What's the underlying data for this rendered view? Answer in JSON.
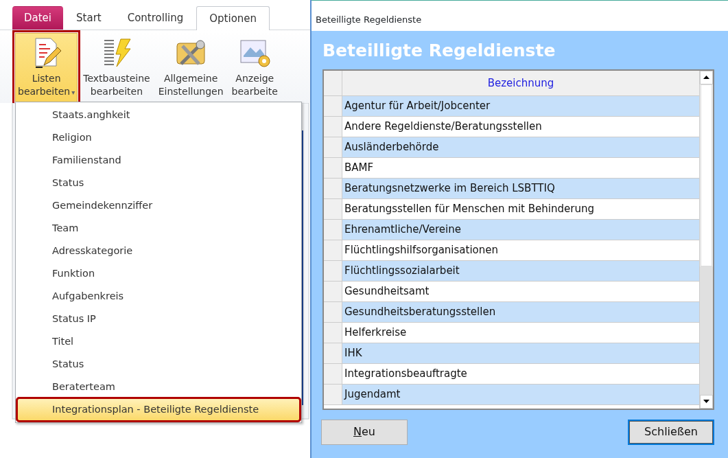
{
  "ribbon": {
    "tabs": [
      {
        "label": "Datei",
        "kind": "file",
        "selected": false
      },
      {
        "label": "Start",
        "kind": "tab",
        "selected": false
      },
      {
        "label": "Controlling",
        "kind": "tab",
        "selected": false
      },
      {
        "label": "Optionen",
        "kind": "tab",
        "selected": true
      }
    ],
    "buttons": [
      {
        "lines": [
          "Listen",
          "bearbeiten"
        ],
        "kind": "list",
        "caret": "▾",
        "selected": true,
        "highlighted": true
      },
      {
        "lines": [
          "Textbausteine",
          "bearbeiten"
        ],
        "kind": "text",
        "selected": false,
        "highlighted": false
      },
      {
        "lines": [
          "Allgemeine",
          "Einstellungen"
        ],
        "kind": "tools",
        "selected": false,
        "highlighted": false
      },
      {
        "lines": [
          "Anzeige",
          "bearbeite"
        ],
        "kind": "display",
        "selected": false,
        "highlighted": false
      }
    ]
  },
  "menu": {
    "items": [
      {
        "label": "Staats.anghkeit",
        "selected": false,
        "highlighted": false
      },
      {
        "label": "Religion",
        "selected": false,
        "highlighted": false
      },
      {
        "label": "Familienstand",
        "selected": false,
        "highlighted": false
      },
      {
        "label": "Status",
        "selected": false,
        "highlighted": false
      },
      {
        "label": "Gemeindekennziffer",
        "selected": false,
        "highlighted": false
      },
      {
        "label": "Team",
        "selected": false,
        "highlighted": false
      },
      {
        "label": "Adresskategorie",
        "selected": false,
        "highlighted": false
      },
      {
        "label": "Funktion",
        "selected": false,
        "highlighted": false
      },
      {
        "label": "Aufgabenkreis",
        "selected": false,
        "highlighted": false
      },
      {
        "label": "Status IP",
        "selected": false,
        "highlighted": false
      },
      {
        "label": "Titel",
        "selected": false,
        "highlighted": false
      },
      {
        "label": "Status",
        "selected": false,
        "highlighted": false
      },
      {
        "label": "Beraterteam",
        "selected": false,
        "highlighted": false
      },
      {
        "label": "Integrationsplan - Beteiligte Regeldienste",
        "selected": true,
        "highlighted": true
      }
    ]
  },
  "window": {
    "title": "Beteilligte Regeldienste",
    "heading": "Beteilligte Regeldienste",
    "table": {
      "columns": [
        "Bezeichnung"
      ],
      "rows": [
        {
          "cells": [
            "Agentur für Arbeit/Jobcenter"
          ]
        },
        {
          "cells": [
            "Andere Regeldienste/Beratungsstellen"
          ]
        },
        {
          "cells": [
            "Ausländerbehörde"
          ]
        },
        {
          "cells": [
            "BAMF"
          ]
        },
        {
          "cells": [
            "Beratungsnetzwerke im Bereich LSBTTIQ"
          ]
        },
        {
          "cells": [
            "Beratungsstellen für Menschen mit Behinderung"
          ]
        },
        {
          "cells": [
            "Ehrenamtliche/Vereine"
          ]
        },
        {
          "cells": [
            "Flüchtlingshilfsorganisationen"
          ]
        },
        {
          "cells": [
            "Flüchtlingssozialarbeit"
          ]
        },
        {
          "cells": [
            "Gesundheitsamt"
          ]
        },
        {
          "cells": [
            "Gesundheitsberatungsstellen"
          ]
        },
        {
          "cells": [
            "Helferkreise"
          ]
        },
        {
          "cells": [
            "IHK"
          ]
        },
        {
          "cells": [
            "Integrationsbeauftragte"
          ]
        },
        {
          "cells": [
            "Jugendamt"
          ]
        }
      ]
    },
    "buttons": [
      {
        "label": "Neu",
        "mnemonic": true,
        "focused": false
      },
      {
        "label": "Schließen",
        "mnemonic": false,
        "focused": true
      }
    ]
  }
}
